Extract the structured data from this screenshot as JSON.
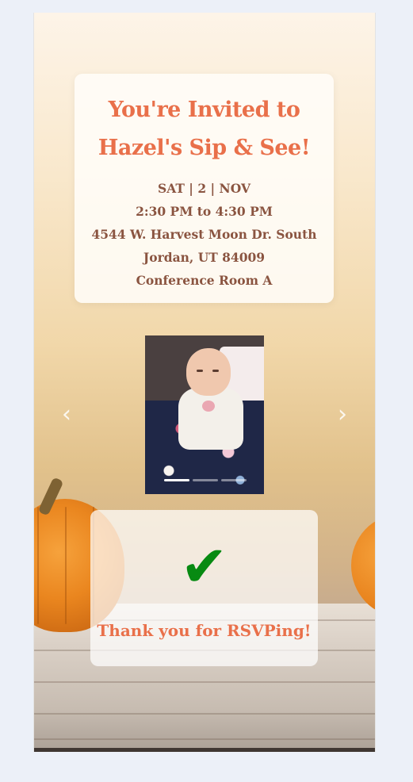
{
  "invitation": {
    "title_line1": "You're Invited to",
    "title_line2": "Hazel's Sip & See!",
    "date": "SAT | 2 | NOV",
    "time": "2:30 PM to 4:30 PM",
    "address_line1": "4544 W. Harvest Moon Dr. South",
    "address_line2": "Jordan, UT 84009",
    "room": "Conference Room A"
  },
  "carousel": {
    "slide_count": 3,
    "active_slide": 1,
    "prev_icon": "chevron-left-icon",
    "next_icon": "chevron-right-icon"
  },
  "rsvp": {
    "icon": "checkmark-icon",
    "message": "Thank you for RSVPing!"
  },
  "colors": {
    "accent": "#e9704a",
    "detail_text": "#8a5440",
    "check": "#078a12",
    "page_background": "#ecf0f8"
  }
}
